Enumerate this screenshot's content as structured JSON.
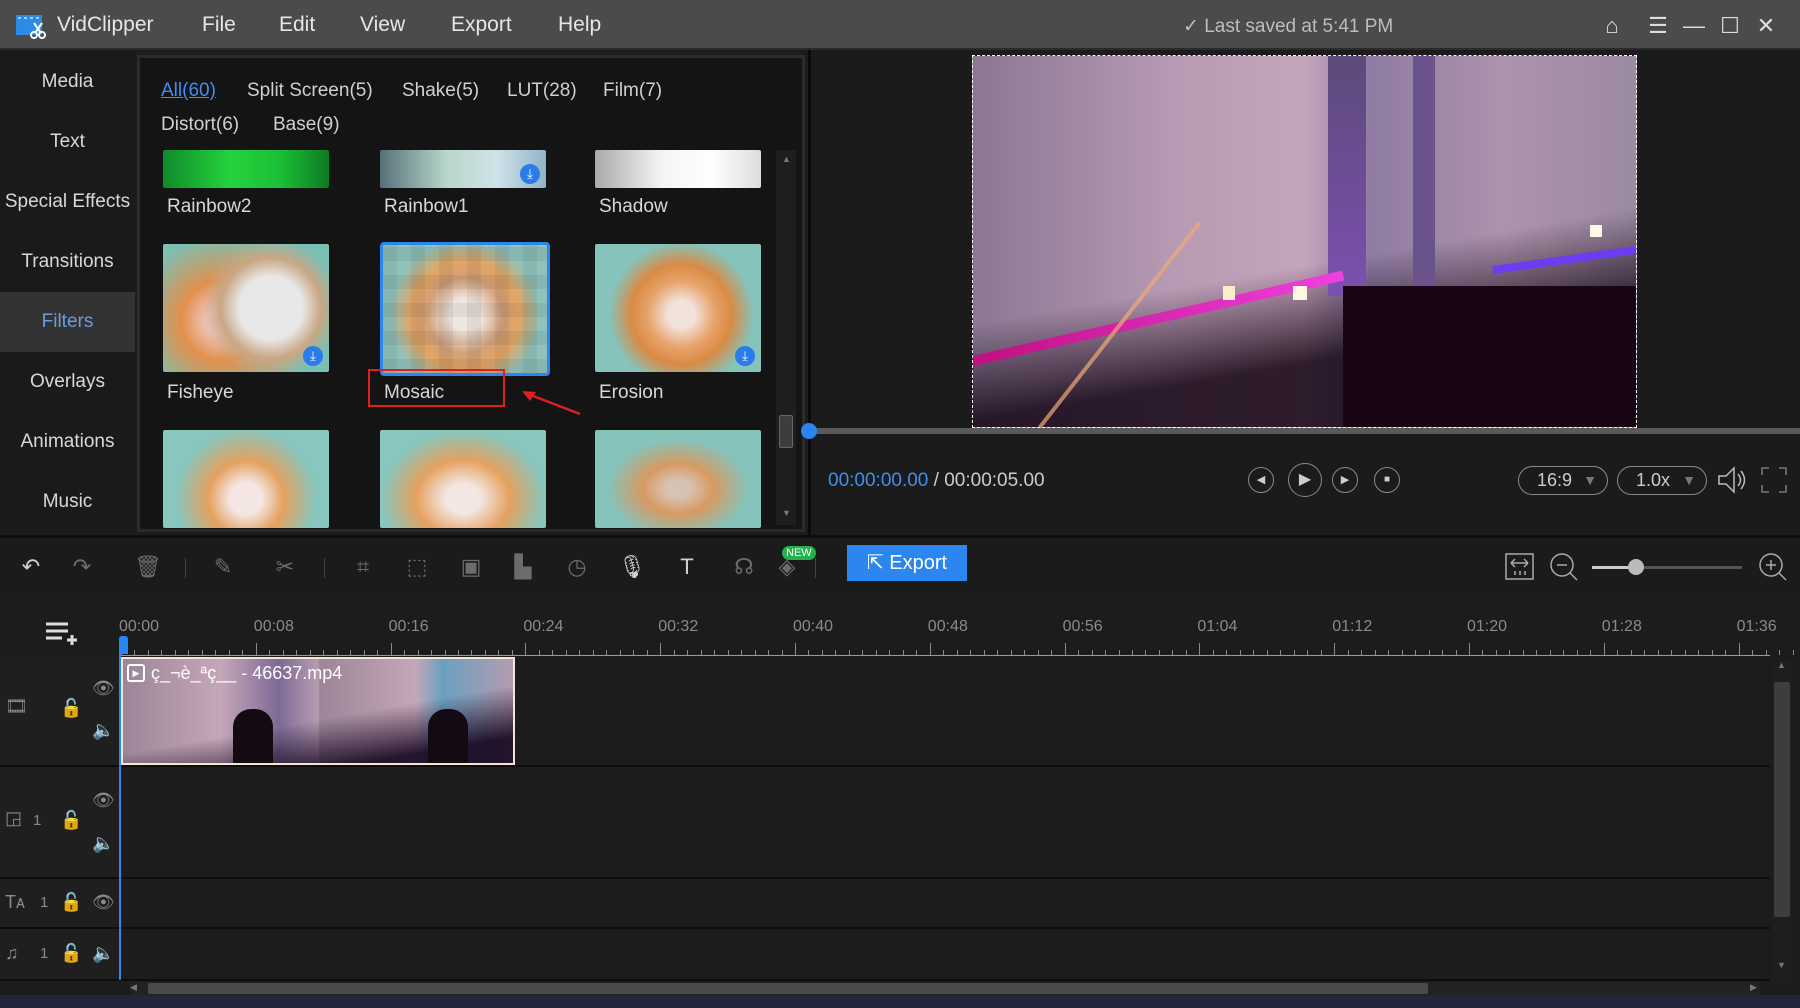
{
  "titlebar": {
    "app_name": "VidClipper",
    "menu": [
      "File",
      "Edit",
      "View",
      "Export",
      "Help"
    ],
    "saved_status": "Last saved at 5:41 PM",
    "icons": [
      "home-icon",
      "menu-icon",
      "minimize-icon",
      "maximize-icon",
      "close-icon"
    ]
  },
  "sidebar": {
    "items": [
      {
        "label": "Media"
      },
      {
        "label": "Text"
      },
      {
        "label": "Special Effects"
      },
      {
        "label": "Transitions"
      },
      {
        "label": "Filters",
        "active": true
      },
      {
        "label": "Overlays"
      },
      {
        "label": "Animations"
      },
      {
        "label": "Music"
      }
    ]
  },
  "filters": {
    "categories": [
      {
        "label": "All(60)",
        "active": true
      },
      {
        "label": "Split Screen(5)"
      },
      {
        "label": "Shake(5)"
      },
      {
        "label": "LUT(28)"
      },
      {
        "label": "Film(7)"
      },
      {
        "label": "Distort(6)"
      },
      {
        "label": "Base(9)"
      }
    ],
    "items": [
      {
        "name": "Rainbow2",
        "download": false
      },
      {
        "name": "Rainbow1",
        "download": true
      },
      {
        "name": "Shadow",
        "download": false
      },
      {
        "name": "Fisheye",
        "download": true
      },
      {
        "name": "Mosaic",
        "download": false,
        "selected": true,
        "highlighted": true
      },
      {
        "name": "Erosion",
        "download": true
      },
      {
        "name": "",
        "download": false
      },
      {
        "name": "",
        "download": false
      },
      {
        "name": "",
        "download": false
      }
    ]
  },
  "player": {
    "current_time": "00:00:00.00",
    "separator": " / ",
    "total_time": "00:00:05.00",
    "aspect_ratio": "16:9",
    "speed": "1.0x",
    "progress": 0
  },
  "toolbar": {
    "export_label": "Export",
    "new_badge": "NEW",
    "zoom_level": 0.29,
    "tools": [
      "undo-icon",
      "redo-icon",
      "delete-icon",
      "edit-icon",
      "cut-icon",
      "crop-icon",
      "freeze-icon",
      "mosaic-icon",
      "audio-meter-icon",
      "speed-icon",
      "record-voice-icon",
      "text-to-speech-icon",
      "speech-to-text-icon",
      "ai-tool-icon"
    ]
  },
  "timeline": {
    "ticks": [
      "00:00",
      "00:08",
      "00:16",
      "00:24",
      "00:32",
      "00:40",
      "00:48",
      "00:56",
      "01:04",
      "01:12",
      "01:20",
      "01:28",
      "01:36"
    ],
    "clip_name": "ç_¬è_ªç__ - 46637.mp4",
    "tracks": [
      {
        "type": "video",
        "label": ""
      },
      {
        "type": "overlay",
        "label": "1"
      },
      {
        "type": "text",
        "label": "1"
      },
      {
        "type": "music",
        "label": "1"
      }
    ]
  },
  "colors": {
    "accent": "#2b86f0",
    "active_sidebar_text": "#6a9be0",
    "highlight_box": "#e02020"
  }
}
